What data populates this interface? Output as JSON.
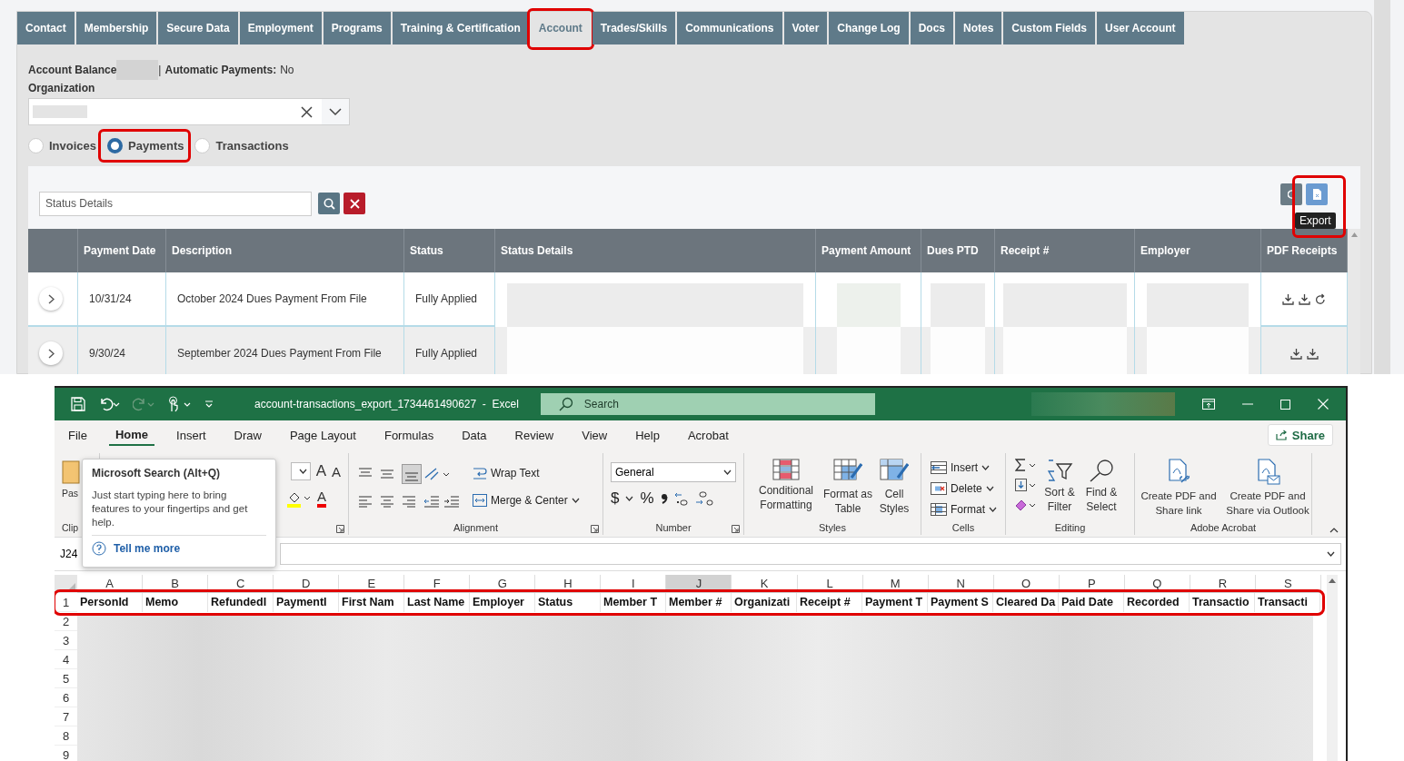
{
  "web": {
    "tabs": [
      {
        "label": "Contact",
        "selected": false,
        "highlighted": false
      },
      {
        "label": "Membership",
        "selected": false,
        "highlighted": false
      },
      {
        "label": "Secure Data",
        "selected": false,
        "highlighted": false
      },
      {
        "label": "Employment",
        "selected": false,
        "highlighted": false
      },
      {
        "label": "Programs",
        "selected": false,
        "highlighted": false
      },
      {
        "label": "Training & Certification",
        "selected": false,
        "highlighted": false
      },
      {
        "label": "Account",
        "selected": true,
        "highlighted": true
      },
      {
        "label": "Trades/Skills",
        "selected": false,
        "highlighted": false
      },
      {
        "label": "Communications",
        "selected": false,
        "highlighted": false
      },
      {
        "label": "Voter",
        "selected": false,
        "highlighted": false
      },
      {
        "label": "Change Log",
        "selected": false,
        "highlighted": false
      },
      {
        "label": "Docs",
        "selected": false,
        "highlighted": false
      },
      {
        "label": "Notes",
        "selected": false,
        "highlighted": false
      },
      {
        "label": "Custom Fields",
        "selected": false,
        "highlighted": false
      },
      {
        "label": "User Account",
        "selected": false,
        "highlighted": false
      }
    ],
    "account": {
      "balance_label": "Account Balance",
      "separator": "|",
      "auto_label": "Automatic Payments:",
      "auto_value": "No"
    },
    "organization_label": "Organization",
    "radios": [
      {
        "label": "Invoices",
        "selected": false,
        "highlighted": false
      },
      {
        "label": "Payments",
        "selected": true,
        "highlighted": true
      },
      {
        "label": "Transactions",
        "selected": false,
        "highlighted": false
      }
    ],
    "search": {
      "placeholder": "Status Details"
    },
    "export": {
      "tooltip": "Export",
      "highlighted": true
    },
    "table": {
      "columns": [
        "Payment Date",
        "Description",
        "Status",
        "Status Details",
        "Payment Amount",
        "Dues PTD",
        "Receipt #",
        "Employer",
        "PDF Receipts"
      ],
      "rows": [
        {
          "payment_date": "10/31/24",
          "description": "October 2024 Dues Payment From File",
          "status": "Fully Applied",
          "receipt_actions": [
            {
              "kind": "download"
            },
            {
              "kind": "download"
            },
            {
              "kind": "refresh"
            }
          ]
        },
        {
          "payment_date": "9/30/24",
          "description": "September 2024 Dues Payment From File",
          "status": "Fully Applied",
          "receipt_actions": [
            {
              "kind": "download"
            },
            {
              "kind": "download"
            }
          ]
        }
      ]
    }
  },
  "excel": {
    "title": "account-transactions_export_1734461490627  -  Excel",
    "search_placeholder": "Search",
    "menu": [
      {
        "label": "File",
        "selected": false
      },
      {
        "label": "Home",
        "selected": true
      },
      {
        "label": "Insert",
        "selected": false
      },
      {
        "label": "Draw",
        "selected": false
      },
      {
        "label": "Page Layout",
        "selected": false
      },
      {
        "label": "Formulas",
        "selected": false
      },
      {
        "label": "Data",
        "selected": false
      },
      {
        "label": "Review",
        "selected": false
      },
      {
        "label": "View",
        "selected": false
      },
      {
        "label": "Help",
        "selected": false
      },
      {
        "label": "Acrobat",
        "selected": false
      }
    ],
    "share": "Share",
    "ribbon": {
      "clipboard": {
        "paste": "Pas",
        "label": "Clip"
      },
      "font": {
        "grow": "A",
        "shrink": "A",
        "font_color_button": "A"
      },
      "alignment": {
        "wrap": "Wrap Text",
        "merge": "Merge & Center",
        "label": "Alignment"
      },
      "number": {
        "format": "General",
        "currency": "$",
        "percent": "%",
        "label": "Number"
      },
      "styles": {
        "items": [
          "Conditional Formatting",
          "Format as Table",
          "Cell Styles"
        ],
        "label": "Styles"
      },
      "cells": {
        "items": [
          "Insert",
          "Delete",
          "Format"
        ],
        "label": "Cells"
      },
      "editing": {
        "items": [
          "Sort & Filter",
          "Find & Select"
        ],
        "label": "Editing"
      },
      "acrobat": {
        "items": [
          "Create PDF and Share link",
          "Create PDF and Share via Outlook"
        ],
        "label": "Adobe Acrobat"
      }
    },
    "tooltip": {
      "title": "Microsoft Search (Alt+Q)",
      "body": "Just start typing here to bring features to your fingertips and get help.",
      "link": "Tell me more"
    },
    "name_box": "J24",
    "columns": [
      {
        "label": "A",
        "selected": false
      },
      {
        "label": "B",
        "selected": false
      },
      {
        "label": "C",
        "selected": false
      },
      {
        "label": "D",
        "selected": false
      },
      {
        "label": "E",
        "selected": false
      },
      {
        "label": "F",
        "selected": false
      },
      {
        "label": "G",
        "selected": false
      },
      {
        "label": "H",
        "selected": false
      },
      {
        "label": "I",
        "selected": false
      },
      {
        "label": "J",
        "selected": true
      },
      {
        "label": "K",
        "selected": false
      },
      {
        "label": "L",
        "selected": false
      },
      {
        "label": "M",
        "selected": false
      },
      {
        "label": "N",
        "selected": false
      },
      {
        "label": "O",
        "selected": false
      },
      {
        "label": "P",
        "selected": false
      },
      {
        "label": "Q",
        "selected": false
      },
      {
        "label": "R",
        "selected": false
      },
      {
        "label": "S",
        "selected": false
      }
    ],
    "rows": [
      "1",
      "2",
      "3",
      "4",
      "5",
      "6",
      "7",
      "8",
      "9"
    ],
    "header_cells": [
      "PersonId",
      "Memo",
      "RefundedI",
      "PaymentI",
      "First Nam",
      "Last Name",
      "Employer",
      "Status",
      "Member T",
      "Member #",
      "Organizati",
      "Receipt #",
      "Payment T",
      "Payment S",
      "Cleared Da",
      "Paid Date",
      "Recorded",
      "Transactio",
      "Transacti"
    ],
    "header_row_highlighted": true
  }
}
